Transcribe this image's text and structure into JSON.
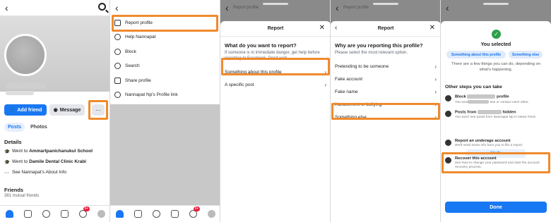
{
  "colors": {
    "accent": "#1877f2",
    "highlight": "#f08a2c",
    "success": "#2ca04a"
  },
  "screen1": {
    "add_friend": "Add friend",
    "message": "Message",
    "more": "···",
    "tabs": [
      "Posts",
      "Photos"
    ],
    "details_title": "Details",
    "details": [
      {
        "prefix": "Went to ",
        "name": "Ammartpanichanukul School"
      },
      {
        "prefix": "Went to ",
        "name": "Damile Dental Clinic Krabi"
      },
      {
        "prefix": "",
        "name": "See Nannapat's About Info"
      }
    ],
    "friends_title": "Friends",
    "friends_sub": "381 mutual friends",
    "notif_badge": "9+"
  },
  "screen2": {
    "menu": [
      {
        "label": "Report profile",
        "icon": "report-icon"
      },
      {
        "label": "Help Nannapat",
        "icon": "help-icon"
      },
      {
        "label": "Block",
        "icon": "block-icon"
      },
      {
        "label": "Search",
        "icon": "search-icon"
      },
      {
        "label": "Share profile",
        "icon": "share-icon"
      },
      {
        "label": "Nannapat Np's Profile link",
        "icon": "link-icon"
      }
    ]
  },
  "screen3": {
    "ghost": "Report profile",
    "title": "Report",
    "question": "What do you want to report?",
    "sub": "If someone is in immediate danger, get help before reporting to Facebook. Don't wait.",
    "options": [
      "Something about this profile",
      "A specific post"
    ]
  },
  "screen4": {
    "ghost": "Report profile",
    "title": "Report",
    "question": "Why are you reporting this profile?",
    "sub": "Please select the most relevant option.",
    "options": [
      "Pretending to be someone",
      "Fake account",
      "Fake name",
      "Harassment or bullying",
      "Something else"
    ]
  },
  "screen5": {
    "you_selected": "You selected",
    "chips": [
      "Something about this profile",
      "Something else"
    ],
    "info": "There are a few things you can do, depending on what's happening.",
    "other_steps": "Other steps you can take",
    "block_title_a": "Block ",
    "block_title_b": "profile",
    "block_sub_a": "You won",
    "block_sub_b": "see or contact each other.",
    "posts_title_a": "Posts from ",
    "posts_title_b": " hidden",
    "posts_sub": "You won't see posts from Nannapat Np in News Feed.",
    "undo": "Undo",
    "underage_title": "Report an underage account",
    "underage_sub": "We'll need some info from you to file a report.",
    "recover_title": "Recover this account",
    "recover_sub": "See how to change your password and start the account recovery process.",
    "done": "Done"
  }
}
